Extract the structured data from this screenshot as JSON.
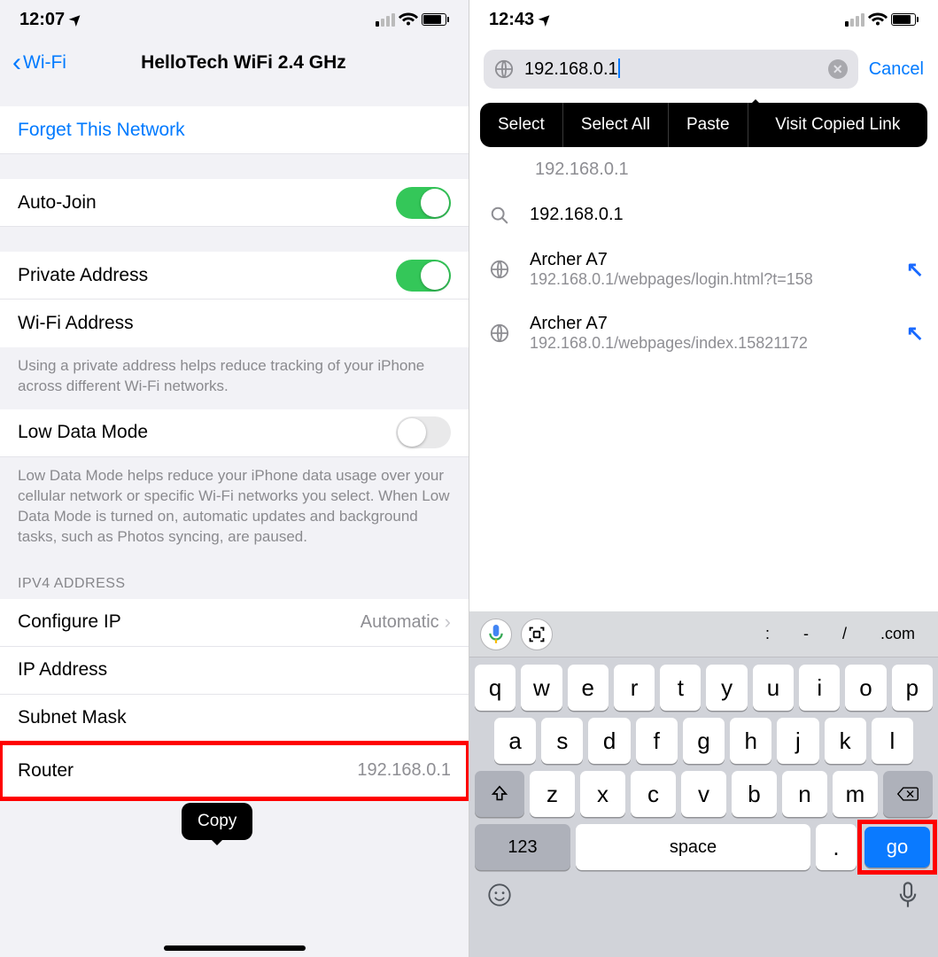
{
  "left": {
    "status": {
      "time": "12:07",
      "location_arrow": "➤"
    },
    "nav": {
      "back_label": "Wi-Fi",
      "title": "HelloTech WiFi 2.4 GHz"
    },
    "forget_row": "Forget This Network",
    "autojoin_row": "Auto-Join",
    "private_address_row": "Private Address",
    "wifi_address_row": "Wi-Fi Address",
    "private_footer": "Using a private address helps reduce tracking of your iPhone across different Wi-Fi networks.",
    "low_data_row": "Low Data Mode",
    "low_data_footer": "Low Data Mode helps reduce your iPhone data usage over your cellular network or specific Wi-Fi networks you select. When Low Data Mode is turned on, automatic updates and background tasks, such as Photos syncing, are paused.",
    "ipv4_header": "IPV4 ADDRESS",
    "configure_ip": {
      "label": "Configure IP",
      "value": "Automatic"
    },
    "ip_address_label": "IP Address",
    "subnet_label": "Subnet Mask",
    "router": {
      "label": "Router",
      "value": "192.168.0.1"
    },
    "copy_tooltip": "Copy"
  },
  "right": {
    "status": {
      "time": "12:43",
      "location_arrow": "➤"
    },
    "url_value": "192.168.0.1",
    "cancel_label": "Cancel",
    "context_menu": [
      "Select",
      "Select All",
      "Paste",
      "Visit Copied Link"
    ],
    "suggestions": [
      {
        "icon": "globe",
        "title": "192.168.0.1",
        "sub": "",
        "arrow": false,
        "dim": true
      },
      {
        "icon": "search",
        "title": "192.168.0.1",
        "sub": "",
        "arrow": false,
        "dim": false
      },
      {
        "icon": "globe",
        "title": "Archer A7",
        "sub": "192.168.0.1/webpages/login.html?t=158",
        "arrow": true,
        "dim": false
      },
      {
        "icon": "globe",
        "title": "Archer A7",
        "sub": "192.168.0.1/webpages/index.15821172",
        "arrow": true,
        "dim": false
      }
    ],
    "keyboard": {
      "accessory_symbols": [
        ":",
        "-",
        "/",
        ".com"
      ],
      "row1": [
        "q",
        "w",
        "e",
        "r",
        "t",
        "y",
        "u",
        "i",
        "o",
        "p"
      ],
      "row2": [
        "a",
        "s",
        "d",
        "f",
        "g",
        "h",
        "j",
        "k",
        "l"
      ],
      "row3": [
        "z",
        "x",
        "c",
        "v",
        "b",
        "n",
        "m"
      ],
      "num_key": "123",
      "space_key": "space",
      "dot_key": ".",
      "go_key": "go"
    }
  }
}
